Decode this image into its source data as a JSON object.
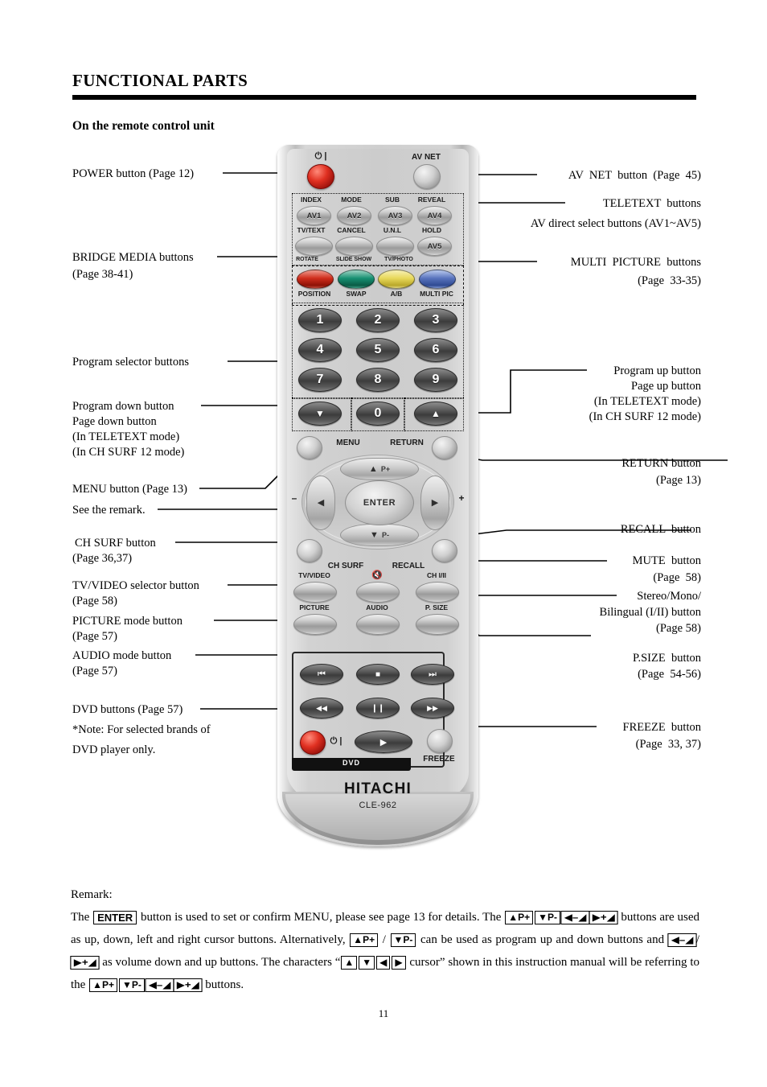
{
  "header": {
    "title": "FUNCTIONAL PARTS",
    "subtitle": "On the remote control unit"
  },
  "left_callouts": [
    {
      "id": "power",
      "lines": [
        "POWER button (Page 12)"
      ]
    },
    {
      "id": "bridge-media",
      "lines": [
        "BRIDGE MEDIA buttons",
        "(Page 38-41)"
      ]
    },
    {
      "id": "program-selector",
      "lines": [
        "Program selector buttons"
      ]
    },
    {
      "id": "program-down",
      "lines": [
        "Program down button",
        "Page down button",
        "(In TELETEXT mode)",
        "(In CH SURF 12 mode)"
      ]
    },
    {
      "id": "menu",
      "lines": [
        "MENU button (Page 13)"
      ]
    },
    {
      "id": "see-remark",
      "lines": [
        "See the remark."
      ]
    },
    {
      "id": "ch-surf",
      "lines": [
        "CH SURF button",
        "(Page 36,37)"
      ]
    },
    {
      "id": "tv-video",
      "lines": [
        "TV/VIDEO selector button",
        "(Page 58)"
      ]
    },
    {
      "id": "picture-mode",
      "lines": [
        "PICTURE mode button",
        "(Page 57)"
      ]
    },
    {
      "id": "audio-mode",
      "lines": [
        "AUDIO mode button",
        "(Page 57)"
      ]
    },
    {
      "id": "dvd",
      "lines": [
        "DVD buttons (Page 57)",
        "*Note: For selected brands of",
        "DVD player only."
      ]
    }
  ],
  "right_callouts": [
    {
      "id": "av-net",
      "lines": [
        "AV  NET  button  (Page  45)"
      ]
    },
    {
      "id": "teletext",
      "lines": [
        "TELETEXT  buttons",
        "AV direct select buttons (AV1~AV5)"
      ]
    },
    {
      "id": "multi-picture",
      "lines": [
        "MULTI  PICTURE  buttons",
        "(Page  33-35)"
      ]
    },
    {
      "id": "program-up",
      "lines": [
        "Program up button",
        "Page up button",
        "(In TELETEXT mode)",
        "(In CH SURF 12 mode)"
      ]
    },
    {
      "id": "return",
      "lines": [
        "RETURN button",
        "(Page 13)"
      ]
    },
    {
      "id": "recall",
      "lines": [
        "RECALL  button"
      ]
    },
    {
      "id": "mute",
      "lines": [
        "MUTE  button",
        "(Page  58)"
      ]
    },
    {
      "id": "stereo-mono",
      "lines": [
        "Stereo/Mono/",
        "Bilingual (I/II) button",
        "(Page 58)"
      ]
    },
    {
      "id": "p-size",
      "lines": [
        "P.SIZE  button",
        "(Page  54-56)"
      ]
    },
    {
      "id": "freeze",
      "lines": [
        "FREEZE  button",
        "(Page  33, 37)"
      ]
    }
  ],
  "remote": {
    "brand": "HITACHI",
    "model": "CLE-962",
    "power_symbol": "⏻ |",
    "av_net_label": "AV NET",
    "teletext": {
      "top_labels": [
        "INDEX",
        "MODE",
        "SUB",
        "REVEAL"
      ],
      "top_buttons": [
        "AV1",
        "AV2",
        "AV3",
        "AV4"
      ],
      "mid_labels": [
        "TV/TEXT",
        "CANCEL",
        "U.N.L",
        "HOLD"
      ],
      "av5_label": "AV5"
    },
    "bridge_media_labels": [
      "ROTATE",
      "SLIDE SHOW",
      "TV/PHOTO"
    ],
    "color_buttons": [
      {
        "label": "POSITION",
        "color": "#cf2d1c"
      },
      {
        "label": "SWAP",
        "color": "#179072"
      },
      {
        "label": "A/B",
        "color": "#e8d85a"
      },
      {
        "label": "MULTI PIC",
        "color": "#5873bd"
      }
    ],
    "numbers": [
      "1",
      "2",
      "3",
      "4",
      "5",
      "6",
      "7",
      "8",
      "9"
    ],
    "zero": "0",
    "prog_down_glyph": "▼",
    "prog_up_glyph": "▲",
    "menu_label": "MENU",
    "return_label": "RETURN",
    "nav": {
      "up": "P+",
      "down": "P-",
      "enter": "ENTER",
      "left_glyph": "◀",
      "right_glyph": "▶",
      "up_glyph": "▲",
      "down_glyph": "▼",
      "vol_down": "–",
      "vol_up": "+"
    },
    "ch_surf_label": "CH SURF",
    "recall_label": "RECALL",
    "func_row1": [
      "TV/VIDEO",
      "MUTE",
      "CH I/II"
    ],
    "func_row2": [
      "PICTURE",
      "AUDIO",
      "P. SIZE"
    ],
    "dvd_label": "DVD",
    "freeze_label": "FREEZE",
    "transport": [
      "⏮",
      "■",
      "⏭",
      "◀◀",
      "❙❙",
      "▶▶",
      "▶"
    ]
  },
  "remark": {
    "heading": "Remark:",
    "t1": "The ",
    "enter": "ENTER",
    "t2": " button is used to set or confirm MENU, please see page 13 for details. The ",
    "k_pplus": "▲P+",
    "k_pminus": "▼P-",
    "k_volminus": "◀–◢",
    "k_volplus": "▶+◢",
    "t3": " buttons are used as up, down, left and right cursor buttons. Alternatively, ",
    "t4": " / ",
    "t5": " can be used as program up and down buttons and ",
    "t6": "/",
    "t7": " as volume down and up buttons. The characters “",
    "k_up": "▲",
    "k_down": "▼",
    "k_left": "◀",
    "k_right": "▶",
    "t8": " cursor” shown in this instruction manual will be referring to the ",
    "t9": " buttons."
  },
  "page_number": "11"
}
